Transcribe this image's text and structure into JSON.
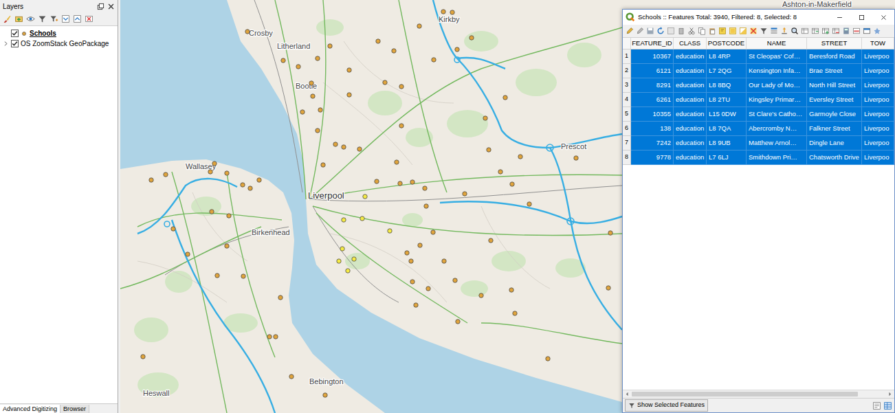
{
  "layers_panel": {
    "title": "Layers",
    "items": [
      {
        "name": "Schools",
        "kind": "point-layer",
        "checked": true,
        "selected": true
      },
      {
        "name": "OS ZoomStack GeoPackage",
        "kind": "group",
        "checked": true,
        "selected": false
      }
    ],
    "tabs": [
      {
        "label": "Advanced Digitizing",
        "selected": true
      },
      {
        "label": "Browser",
        "selected": false
      }
    ]
  },
  "map": {
    "labels": [
      "Ashton-in-Makerfield",
      "Crosby",
      "Kirkby",
      "Litherland",
      "Bootle",
      "Prescot",
      "Wallasey",
      "Liverpool",
      "Birkenhead",
      "Bebington",
      "Heswall"
    ],
    "points": [
      {
        "selected": false
      },
      {
        "selected": false
      },
      {
        "selected": false
      },
      {
        "selected": false
      },
      {
        "selected": false
      },
      {
        "selected": false
      },
      {
        "selected": false
      },
      {
        "selected": false
      },
      {
        "selected": false
      },
      {
        "selected": false
      },
      {
        "selected": false
      },
      {
        "selected": false
      },
      {
        "selected": false
      },
      {
        "selected": false
      },
      {
        "selected": false
      },
      {
        "selected": false
      },
      {
        "selected": false
      },
      {
        "selected": false
      },
      {
        "selected": false
      },
      {
        "selected": false
      },
      {
        "selected": false
      },
      {
        "selected": false
      },
      {
        "selected": false
      },
      {
        "selected": false
      },
      {
        "selected": false
      },
      {
        "selected": false
      },
      {
        "selected": false
      },
      {
        "selected": false
      },
      {
        "selected": false
      },
      {
        "selected": false
      },
      {
        "selected": false
      },
      {
        "selected": false
      },
      {
        "selected": false
      },
      {
        "selected": false
      },
      {
        "selected": false
      },
      {
        "selected": false
      },
      {
        "selected": false
      },
      {
        "selected": false
      },
      {
        "selected": false
      },
      {
        "selected": false
      },
      {
        "selected": false
      },
      {
        "selected": false
      },
      {
        "selected": false
      },
      {
        "selected": false
      },
      {
        "selected": false
      },
      {
        "selected": false
      },
      {
        "selected": false
      },
      {
        "selected": false
      },
      {
        "selected": false
      },
      {
        "selected": false
      },
      {
        "selected": false
      },
      {
        "selected": false
      },
      {
        "selected": false
      },
      {
        "selected": false
      },
      {
        "selected": false
      },
      {
        "selected": false
      },
      {
        "selected": false
      },
      {
        "selected": false
      },
      {
        "selected": false
      },
      {
        "selected": false
      },
      {
        "selected": false
      },
      {
        "selected": false
      },
      {
        "selected": false
      },
      {
        "selected": false
      },
      {
        "selected": false
      },
      {
        "selected": false
      },
      {
        "selected": false
      },
      {
        "selected": false
      },
      {
        "selected": false
      },
      {
        "selected": false
      },
      {
        "selected": false
      },
      {
        "selected": false
      },
      {
        "selected": false
      },
      {
        "selected": false
      },
      {
        "selected": false
      },
      {
        "selected": false
      },
      {
        "selected": false
      },
      {
        "selected": false
      },
      {
        "selected": false
      },
      {
        "selected": false
      },
      {
        "selected": true
      },
      {
        "selected": true
      },
      {
        "selected": true
      },
      {
        "selected": true
      },
      {
        "selected": true
      },
      {
        "selected": true
      },
      {
        "selected": true
      },
      {
        "selected": true
      }
    ]
  },
  "attribute_window": {
    "title": "Schools :: Features Total: 3940, Filtered: 8, Selected: 8",
    "columns": [
      "FEATURE_ID",
      "CLASS",
      "POSTCODE",
      "NAME",
      "STREET",
      "TOW"
    ],
    "rows": [
      {
        "number": "1",
        "cells": [
          "10367",
          "education",
          "L8 4RP",
          "St Cleopas' Cof…",
          "Beresford Road",
          "Liverpoo"
        ],
        "selected": true
      },
      {
        "number": "2",
        "cells": [
          "6121",
          "education",
          "L7 2QG",
          "Kensington Infa…",
          "Brae Street",
          "Liverpoo"
        ],
        "selected": true
      },
      {
        "number": "3",
        "cells": [
          "8291",
          "education",
          "L8 8BQ",
          "Our Lady of Mo…",
          "North Hill Street",
          "Liverpoo"
        ],
        "selected": true
      },
      {
        "number": "4",
        "cells": [
          "6261",
          "education",
          "L8 2TU",
          "Kingsley Primar…",
          "Eversley Street",
          "Liverpoo"
        ],
        "selected": true
      },
      {
        "number": "5",
        "cells": [
          "10355",
          "education",
          "L15 0DW",
          "St Clare's Catho…",
          "Garmoyle Close",
          "Liverpoo"
        ],
        "selected": true
      },
      {
        "number": "6",
        "cells": [
          "138",
          "education",
          "L8 7QA",
          "Abercromby N…",
          "Falkner Street",
          "Liverpoo"
        ],
        "selected": true
      },
      {
        "number": "7",
        "cells": [
          "7242",
          "education",
          "L8 9UB",
          "Matthew Arnol…",
          "Dingle Lane",
          "Liverpoo"
        ],
        "selected": true
      },
      {
        "number": "8",
        "cells": [
          "9778",
          "education",
          "L7 6LJ",
          "Smithdown Pri…",
          "Chatsworth Drive",
          "Liverpoo"
        ],
        "selected": true
      }
    ],
    "status_button": "Show Selected Features"
  }
}
